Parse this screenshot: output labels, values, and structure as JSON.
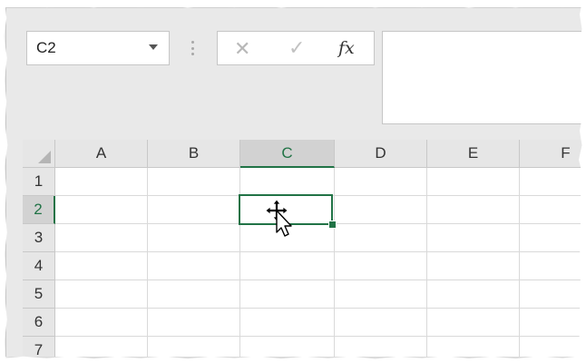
{
  "name_box": {
    "value": "C2"
  },
  "formula_bar": {
    "cancel_icon": "x-icon",
    "enter_icon": "check-icon",
    "function_label": "fx",
    "content": ""
  },
  "columns": [
    "A",
    "B",
    "C",
    "D",
    "E",
    "F"
  ],
  "rows": [
    "1",
    "2",
    "3",
    "4",
    "5",
    "6",
    "7"
  ],
  "selection": {
    "cell": "C2",
    "column": "C",
    "row": "2"
  },
  "colors": {
    "accent": "#217346",
    "header_bg": "#e6e6e6",
    "selected_header_bg": "#d2d2d2"
  },
  "cursor_icon": "move-cursor-icon"
}
